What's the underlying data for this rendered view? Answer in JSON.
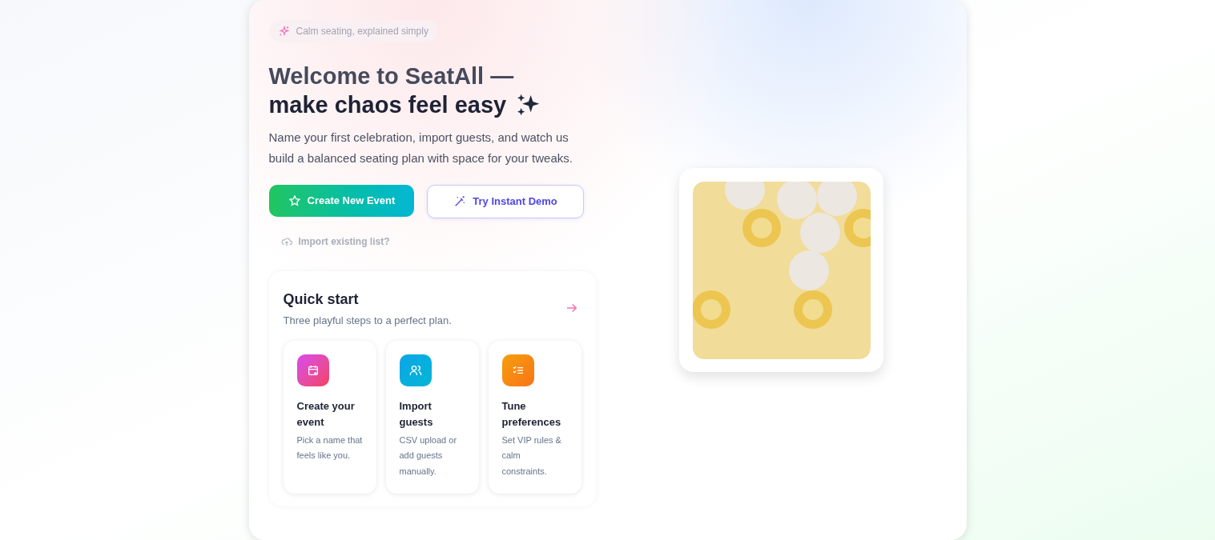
{
  "badge": {
    "text": "Calm seating, explained simply"
  },
  "heading": {
    "line_1": "Welcome to SeatAll —",
    "line_2": "make chaos feel easy"
  },
  "intro": "Name your first celebration, import guests, and watch us build a balanced seating plan with space for your tweaks.",
  "buttons": [
    {
      "kind": "primary",
      "label": "Create New Event"
    },
    {
      "kind": "secondary",
      "label": "Try Instant Demo"
    }
  ],
  "import_link": "Import existing list?",
  "quick_start": {
    "title": "Quick start",
    "subtitle": "Three playful steps to a perfect plan.",
    "steps": [
      {
        "kind": "calendar",
        "title": "Create your event",
        "text": "Pick a name that feels like you."
      },
      {
        "kind": "guests",
        "title": "Import guests",
        "text": "CSV upload or add guests manually."
      },
      {
        "kind": "checklist",
        "title": "Tune preferences",
        "text": "Set VIP rules & calm constraints."
      }
    ]
  }
}
